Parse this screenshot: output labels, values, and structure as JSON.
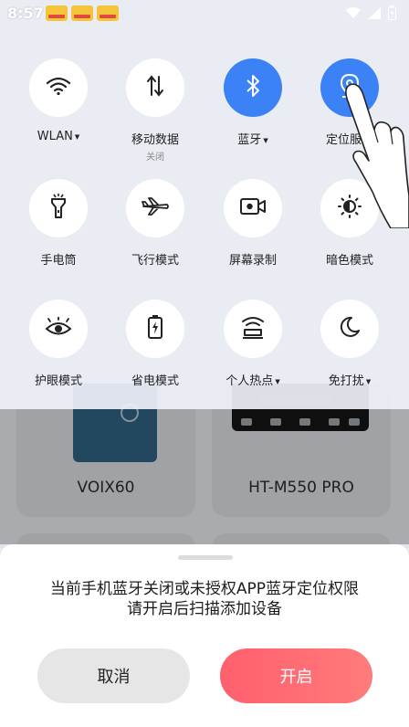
{
  "status_bar": {
    "time": "8:57"
  },
  "quick_settings": {
    "tiles": [
      {
        "label": "WLAN",
        "sub": "",
        "has_caret": true,
        "active": false,
        "icon": "wifi-icon"
      },
      {
        "label": "移动数据",
        "sub": "关闭",
        "has_caret": false,
        "active": false,
        "icon": "mobile-data-icon"
      },
      {
        "label": "蓝牙",
        "sub": "",
        "has_caret": true,
        "active": true,
        "icon": "bluetooth-icon"
      },
      {
        "label": "定位服务",
        "sub": "",
        "has_caret": false,
        "active": true,
        "icon": "location-icon"
      },
      {
        "label": "手电筒",
        "sub": "",
        "has_caret": false,
        "active": false,
        "icon": "flashlight-icon"
      },
      {
        "label": "飞行模式",
        "sub": "",
        "has_caret": false,
        "active": false,
        "icon": "airplane-icon"
      },
      {
        "label": "屏幕录制",
        "sub": "",
        "has_caret": false,
        "active": false,
        "icon": "screen-record-icon"
      },
      {
        "label": "暗色模式",
        "sub": "",
        "has_caret": false,
        "active": false,
        "icon": "dark-mode-icon"
      },
      {
        "label": "护眼模式",
        "sub": "",
        "has_caret": false,
        "active": false,
        "icon": "eye-icon"
      },
      {
        "label": "省电模式",
        "sub": "",
        "has_caret": false,
        "active": false,
        "icon": "battery-saver-icon"
      },
      {
        "label": "个人热点",
        "sub": "",
        "has_caret": true,
        "active": false,
        "icon": "hotspot-icon"
      },
      {
        "label": "免打扰",
        "sub": "",
        "has_caret": true,
        "active": false,
        "icon": "moon-icon"
      }
    ]
  },
  "devices": [
    {
      "name": "VOIX60"
    },
    {
      "name": "HT-M550 PRO"
    }
  ],
  "sheet": {
    "message_line1": "当前手机蓝牙关闭或未授权APP蓝牙定位权限",
    "message_line2": "请开启后扫描添加设备",
    "cancel_label": "取消",
    "open_label": "开启"
  },
  "colors": {
    "active_tile": "#3b82f6",
    "open_button": "#ff6b6b"
  }
}
